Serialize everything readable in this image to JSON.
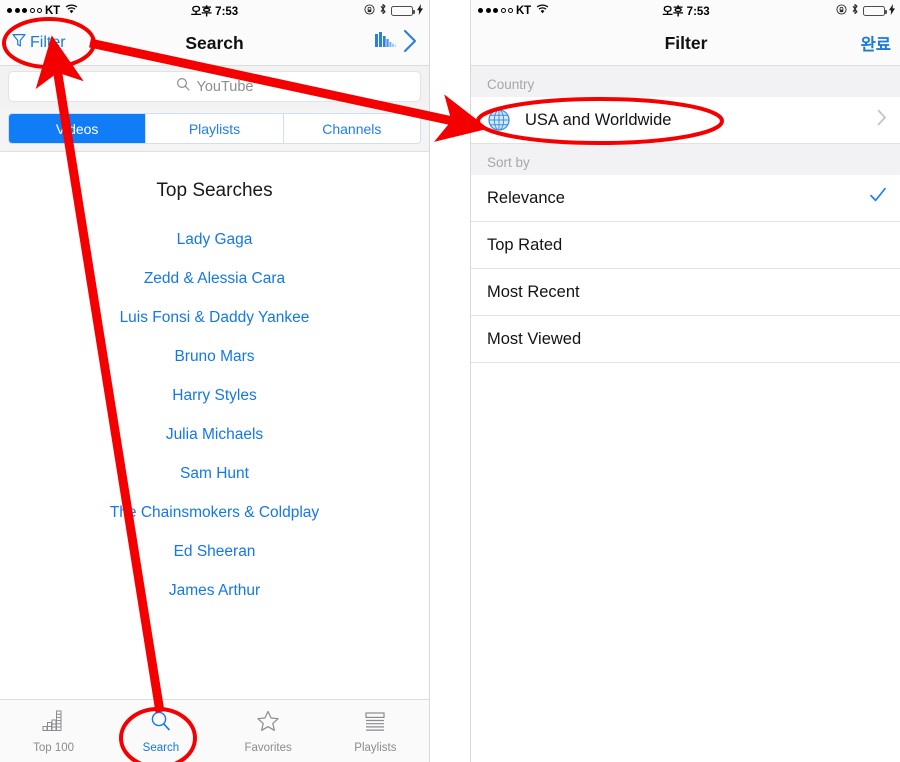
{
  "left_phone": {
    "status_bar": {
      "carrier": "KT",
      "time": "오후 7:53",
      "signal_dots_filled": 3,
      "signal_dots_total": 5,
      "wifi_icon": "wifi-icon",
      "rotation_lock_icon": "rotation-lock-icon",
      "bluetooth_icon": "bluetooth-icon",
      "battery_icon": "battery-icon",
      "charging_icon": "lightning-bolt-icon",
      "battery_color": "#4cd137"
    },
    "nav_bar": {
      "left_button_label": "Filter",
      "left_button_icon": "funnel-icon",
      "title": "Search",
      "right_chart_icon": "bar-chart-icon",
      "right_chevron_icon": "chevron-right-icon",
      "accent_color": "#1c7bd6"
    },
    "search": {
      "placeholder": "YouTube",
      "icon": "magnifier-icon"
    },
    "segmented_control": {
      "active_index": 0,
      "segments": [
        {
          "label": "Videos"
        },
        {
          "label": "Playlists"
        },
        {
          "label": "Channels"
        }
      ],
      "active_color": "#107cf5"
    },
    "top_searches": {
      "heading": "Top Searches",
      "items": [
        "Lady Gaga",
        "Zedd & Alessia Cara",
        "Luis Fonsi & Daddy Yankee",
        "Bruno Mars",
        "Harry Styles",
        "Julia Michaels",
        "Sam Hunt",
        "The Chainsmokers & Coldplay",
        "Ed Sheeran",
        "James Arthur"
      ],
      "link_color": "#1478e8"
    },
    "tab_bar": {
      "active_index": 1,
      "tabs": [
        {
          "label": "Top 100",
          "icon": "bar-chart-icon"
        },
        {
          "label": "Search",
          "icon": "magnifier-icon"
        },
        {
          "label": "Favorites",
          "icon": "star-icon"
        },
        {
          "label": "Playlists",
          "icon": "list-lines-icon"
        }
      ]
    }
  },
  "right_phone": {
    "status_bar": {
      "carrier": "KT",
      "time": "오후 7:53",
      "signal_dots_filled": 3,
      "signal_dots_total": 5,
      "wifi_icon": "wifi-icon",
      "rotation_lock_icon": "rotation-lock-icon",
      "bluetooth_icon": "bluetooth-icon",
      "battery_icon": "battery-icon",
      "charging_icon": "lightning-bolt-icon",
      "battery_color": "#4cd137"
    },
    "nav_bar": {
      "title": "Filter",
      "done_label": "완료",
      "accent_color": "#1c7bd6"
    },
    "country_section": {
      "header": "Country",
      "row": {
        "label": "USA and Worldwide",
        "icon": "globe-icon",
        "accessory_icon": "chevron-right-icon"
      }
    },
    "sort_section": {
      "header": "Sort by",
      "selected_index": 0,
      "options": [
        {
          "label": "Relevance",
          "selected": true
        },
        {
          "label": "Top Rated",
          "selected": false
        },
        {
          "label": "Most Recent",
          "selected": false
        },
        {
          "label": "Most Viewed",
          "selected": false
        }
      ],
      "check_icon": "checkmark-icon",
      "check_color": "#1e82e8"
    }
  },
  "annotations": {
    "color": "#f40000",
    "shapes": [
      {
        "type": "ellipse",
        "target": "filter-button"
      },
      {
        "type": "ellipse",
        "target": "search-tab"
      },
      {
        "type": "ellipse",
        "target": "country-row"
      },
      {
        "type": "arrow",
        "from": "filter-button",
        "to": "country-row"
      },
      {
        "type": "arrow",
        "from": "search-tab",
        "to": "filter-button"
      }
    ]
  }
}
